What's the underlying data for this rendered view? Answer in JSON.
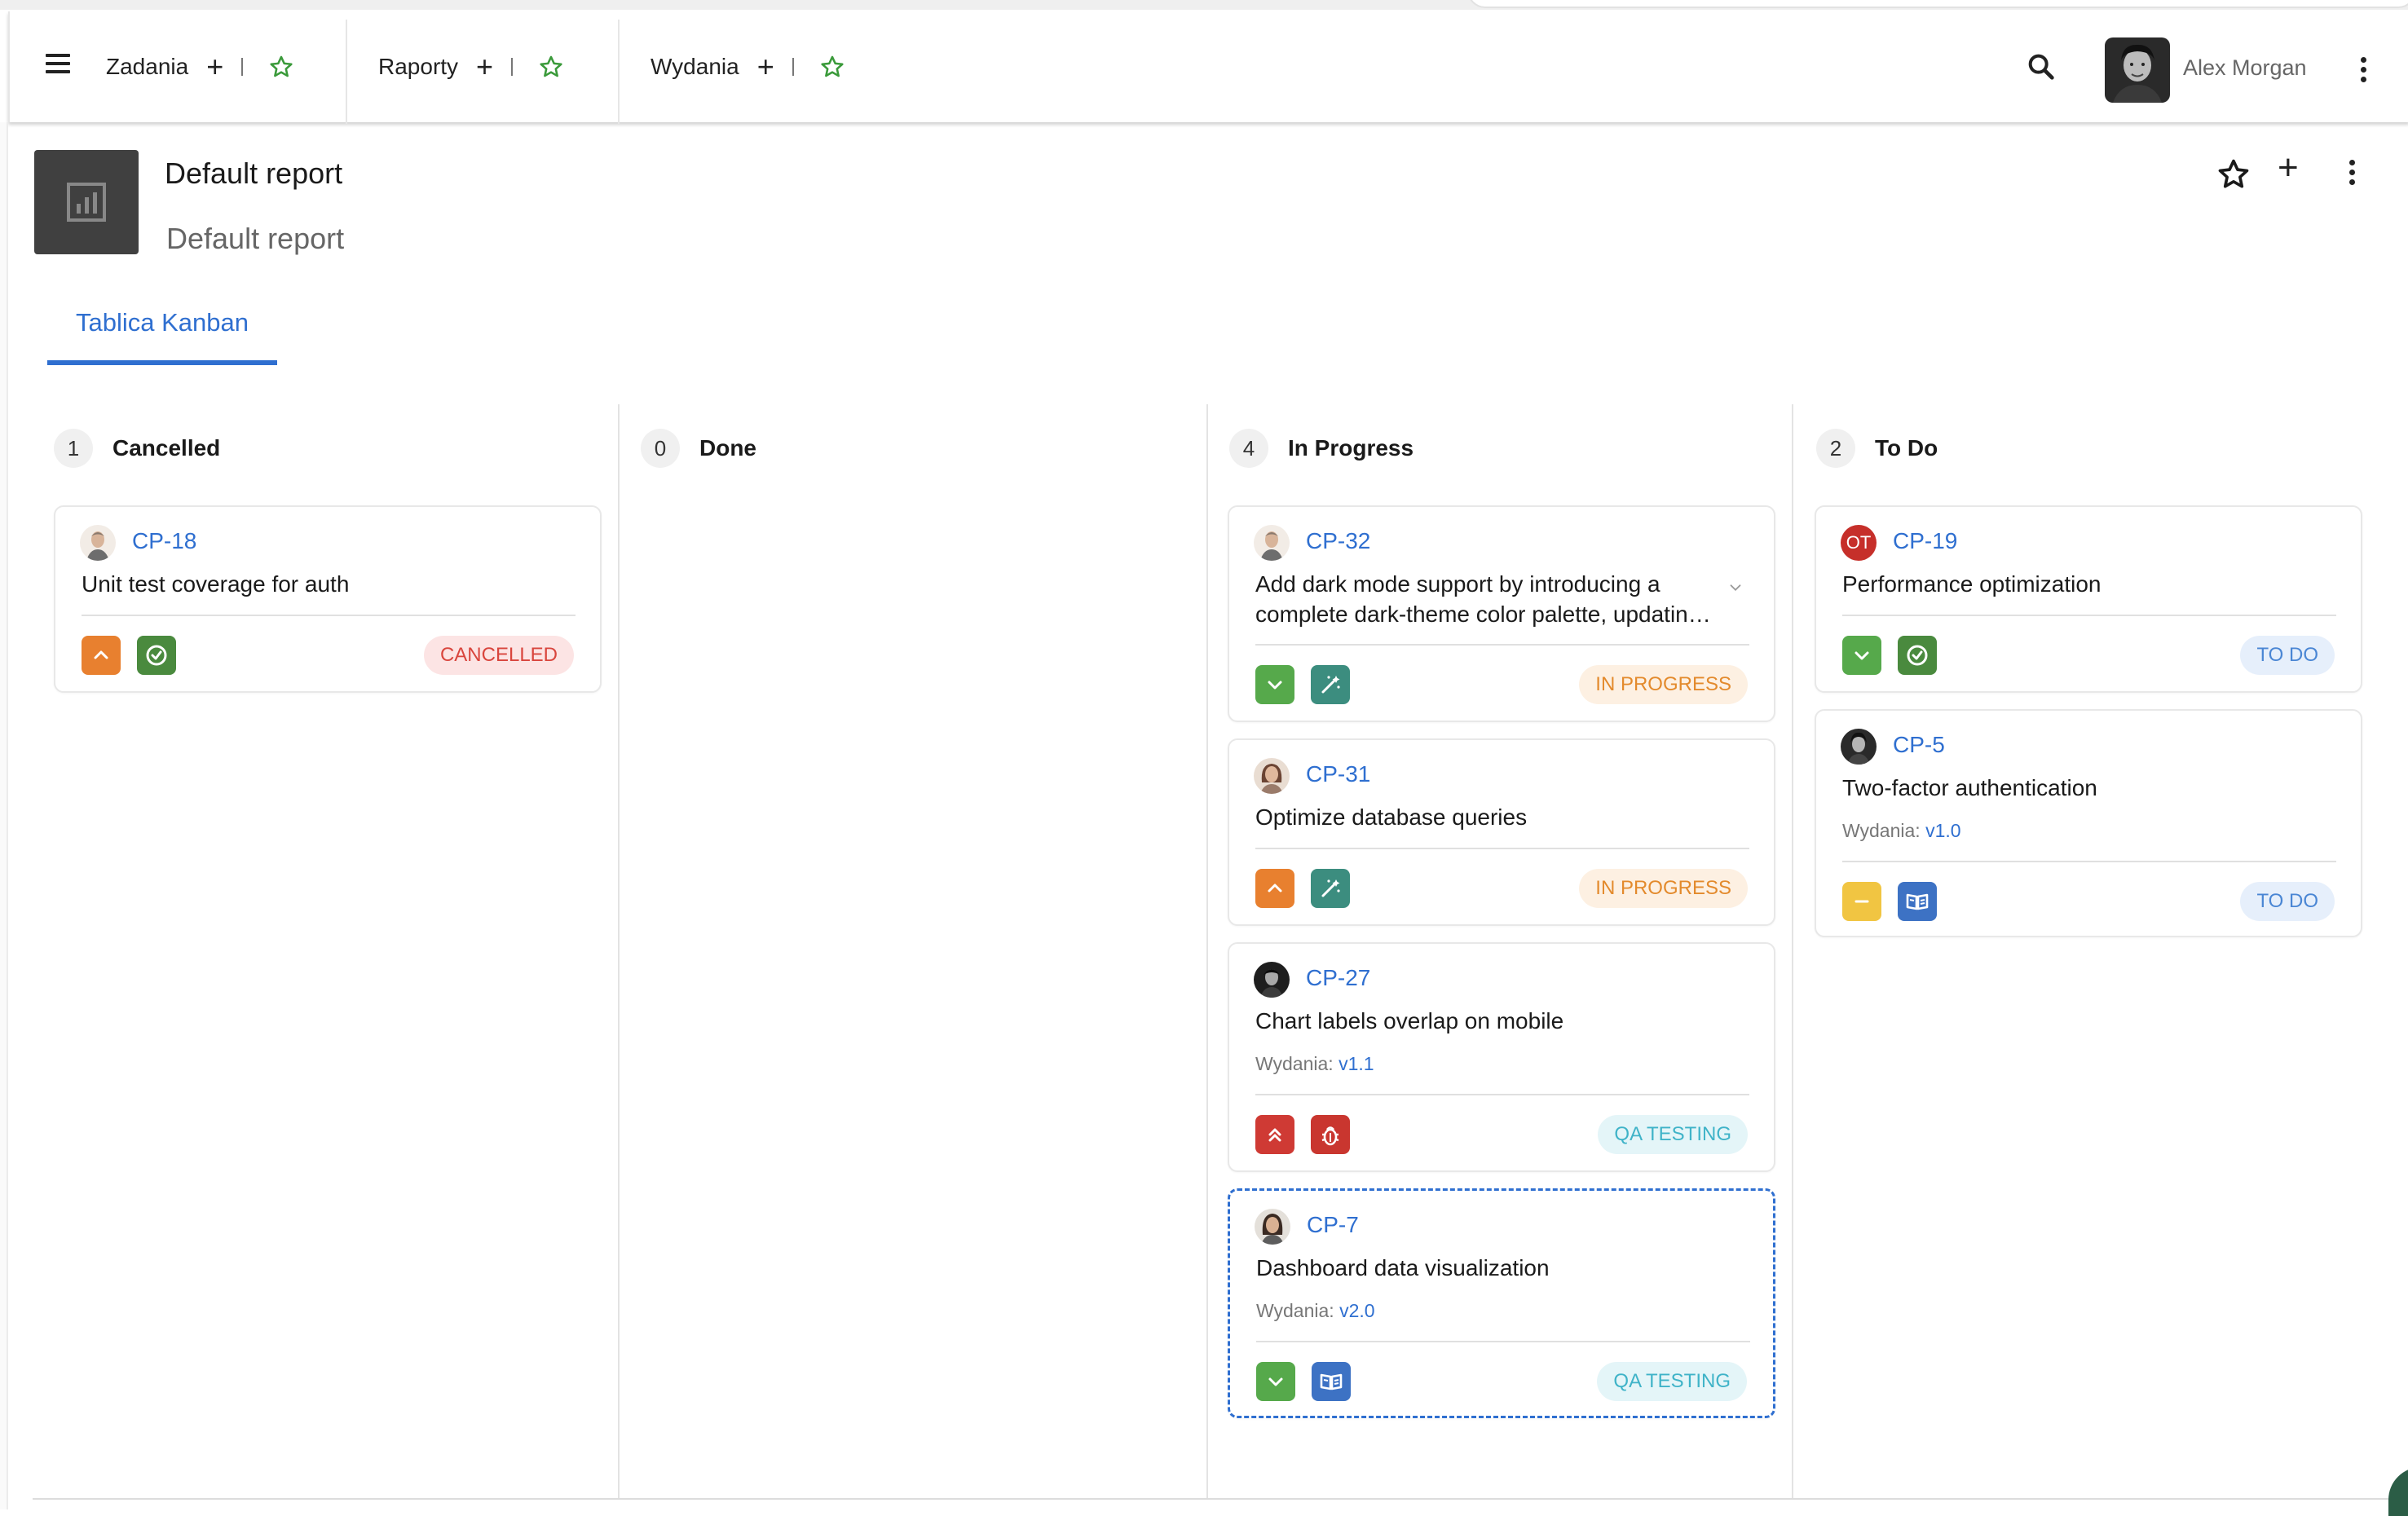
{
  "appbar": {
    "nav": [
      {
        "label": "Zadania"
      },
      {
        "label": "Raporty"
      },
      {
        "label": "Wydania"
      }
    ],
    "user_name": "Alex Morgan"
  },
  "report": {
    "title": "Default report",
    "subtitle": "Default report"
  },
  "tabs": [
    {
      "label": "Tablica Kanban",
      "active": true
    }
  ],
  "columns": [
    {
      "count": "1",
      "title": "Cancelled"
    },
    {
      "count": "0",
      "title": "Done"
    },
    {
      "count": "4",
      "title": "In Progress"
    },
    {
      "count": "2",
      "title": "To Do"
    }
  ],
  "cards": {
    "cp18": {
      "key": "CP-18",
      "title": "Unit test coverage for auth",
      "status": "CANCELLED",
      "priority": "high",
      "type": "task"
    },
    "cp32": {
      "key": "CP-32",
      "title": "Add dark mode support by introducing a complete dark-theme color palette, updatin…",
      "status": "IN PROGRESS",
      "priority": "low",
      "type": "improvement"
    },
    "cp31": {
      "key": "CP-31",
      "title": "Optimize database queries",
      "status": "IN PROGRESS",
      "priority": "high",
      "type": "improvement"
    },
    "cp27": {
      "key": "CP-27",
      "title": "Chart labels overlap on mobile",
      "version_label": "Wydania:",
      "version": "v1.1",
      "status": "QA TESTING",
      "priority": "highest",
      "type": "bug"
    },
    "cp7": {
      "key": "CP-7",
      "title": "Dashboard data visualization",
      "version_label": "Wydania:",
      "version": "v2.0",
      "status": "QA TESTING",
      "priority": "low",
      "type": "story"
    },
    "cp19": {
      "key": "CP-19",
      "assignee_initials": "OT",
      "title": "Performance optimization",
      "status": "TO DO",
      "priority": "low",
      "type": "task"
    },
    "cp5": {
      "key": "CP-5",
      "title": "Two-factor authentication",
      "version_label": "Wydania:",
      "version": "v1.0",
      "status": "TO DO",
      "priority": "medium",
      "type": "story"
    }
  },
  "colors": {
    "accent": "#2f6fd0",
    "priority_high": "#e8802f",
    "priority_low": "#56a94b",
    "priority_highest": "#cf3a34",
    "priority_medium": "#f1c542",
    "type_task": "#4a8a3e",
    "type_improvement": "#3c8d7f",
    "type_bug": "#c9362f",
    "type_story": "#3d72c4"
  }
}
